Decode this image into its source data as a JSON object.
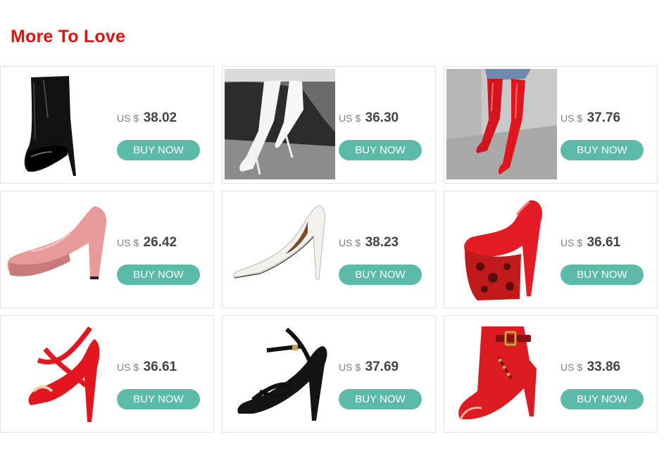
{
  "section": {
    "title": "More To Love"
  },
  "products": [
    {
      "image": "black-platform-ankle-boot",
      "currency": "US $",
      "price": "38.02",
      "cta": "BUY NOW"
    },
    {
      "image": "white-thigh-high-boot-photo",
      "currency": "US $",
      "price": "36.30",
      "cta": "BUY NOW"
    },
    {
      "image": "red-thigh-high-boot-photo",
      "currency": "US $",
      "price": "37.76",
      "cta": "BUY NOW"
    },
    {
      "image": "pink-platform-pump",
      "currency": "US $",
      "price": "26.42",
      "cta": "BUY NOW"
    },
    {
      "image": "white-pointed-stiletto",
      "currency": "US $",
      "price": "38.23",
      "cta": "BUY NOW"
    },
    {
      "image": "red-leopard-platform-pump",
      "currency": "US $",
      "price": "36.61",
      "cta": "BUY NOW"
    },
    {
      "image": "red-strappy-peep-toe-heel",
      "currency": "US $",
      "price": "36.61",
      "cta": "BUY NOW"
    },
    {
      "image": "black-strappy-sandal-heel",
      "currency": "US $",
      "price": "37.69",
      "cta": "BUY NOW"
    },
    {
      "image": "red-buckle-peep-toe-bootie",
      "currency": "US $",
      "price": "33.86",
      "cta": "BUY NOW"
    }
  ]
}
